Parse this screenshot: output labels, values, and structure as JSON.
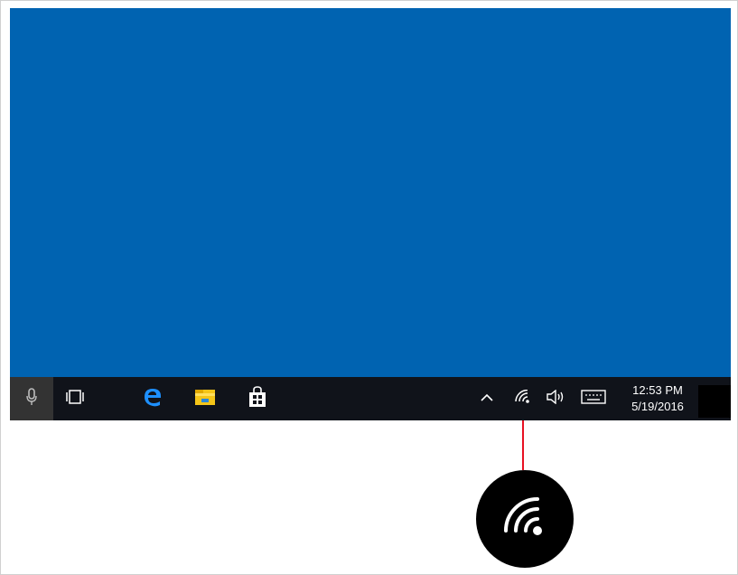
{
  "desktop": {
    "background_color": "#0063b1"
  },
  "taskbar": {
    "background_color": "#10131a",
    "buttons": [
      {
        "name": "cortana-mic",
        "icon": "microphone-icon"
      },
      {
        "name": "task-view",
        "icon": "task-view-icon"
      },
      {
        "name": "edge",
        "icon": "edge-browser-icon"
      },
      {
        "name": "file-explorer",
        "icon": "folder-icon"
      },
      {
        "name": "store",
        "icon": "store-bag-icon"
      }
    ],
    "tray": {
      "icons": [
        "chevron-up-icon",
        "wifi-icon",
        "volume-icon",
        "keyboard-icon"
      ],
      "time": "12:53 PM",
      "date": "5/19/2016"
    }
  },
  "callout": {
    "icon": "wifi-icon",
    "line_color": "#e81123"
  }
}
